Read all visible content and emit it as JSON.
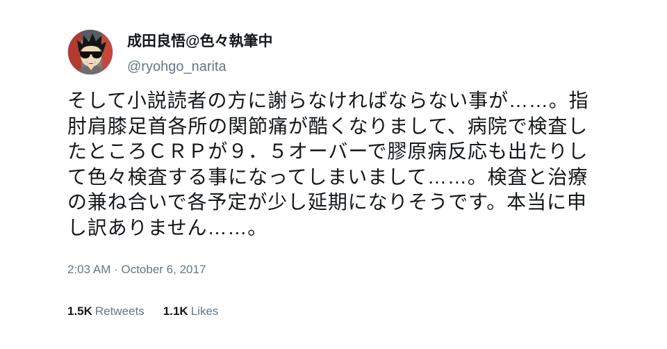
{
  "user": {
    "display_name": "成田良悟@色々執筆中",
    "handle": "@ryohgo_narita",
    "avatar_icon": "cartoon-avatar-sunglasses"
  },
  "tweet": {
    "text_lines": [
      "そして小説読者の方に謝らなければならない事が……。指",
      "肘肩膝足首各所の関節痛が酷くなりまして、病院で検査し",
      "たところＣＲＰが９．５オーバーで膠原病反応も出たりし",
      "て色々検査する事になってしまいまして……。検査と治療",
      "の兼ね合いで各予定が少し延期になりそうです。本当に申",
      "し訳ありません……。"
    ],
    "timestamp": "2:03 AM · October 6, 2017"
  },
  "stats": {
    "retweets_count": "1.5K",
    "retweets_label": "Retweets",
    "likes_count": "1.1K",
    "likes_label": "Likes"
  },
  "colors": {
    "primary_text": "#14171a",
    "secondary_text": "#657786",
    "background": "#ffffff"
  }
}
